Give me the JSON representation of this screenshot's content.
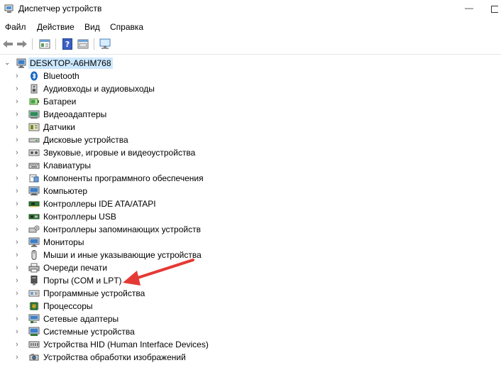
{
  "window": {
    "title": "Диспетчер устройств",
    "minimize_glyph": "—"
  },
  "menu": {
    "items": [
      {
        "label": "Файл"
      },
      {
        "label": "Действие"
      },
      {
        "label": "Вид"
      },
      {
        "label": "Справка"
      }
    ]
  },
  "toolbar": {
    "buttons": [
      "back-arrow-icon",
      "forward-arrow-icon",
      "properties-icon",
      "help-icon",
      "update-driver-icon",
      "scan-hardware-icon"
    ]
  },
  "tree": {
    "root": {
      "label": "DESKTOP-A6HM768",
      "expanded_glyph": "⌄"
    },
    "collapsed_glyph": "›",
    "categories": [
      {
        "label": "Bluetooth",
        "icon": "bluetooth-icon"
      },
      {
        "label": "Аудиовходы и аудиовыходы",
        "icon": "speaker-icon"
      },
      {
        "label": "Батареи",
        "icon": "battery-icon"
      },
      {
        "label": "Видеоадаптеры",
        "icon": "display-adapter-icon"
      },
      {
        "label": "Датчики",
        "icon": "sensor-icon"
      },
      {
        "label": "Дисковые устройства",
        "icon": "disk-drive-icon"
      },
      {
        "label": "Звуковые, игровые и видеоустройства",
        "icon": "sound-icon"
      },
      {
        "label": "Клавиатуры",
        "icon": "keyboard-icon"
      },
      {
        "label": "Компоненты программного обеспечения",
        "icon": "software-component-icon"
      },
      {
        "label": "Компьютер",
        "icon": "computer-icon"
      },
      {
        "label": "Контроллеры IDE ATA/ATAPI",
        "icon": "ide-controller-icon"
      },
      {
        "label": "Контроллеры USB",
        "icon": "usb-icon"
      },
      {
        "label": "Контроллеры запоминающих устройств",
        "icon": "storage-controller-icon"
      },
      {
        "label": "Мониторы",
        "icon": "monitor-icon"
      },
      {
        "label": "Мыши и иные указывающие устройства",
        "icon": "mouse-icon"
      },
      {
        "label": "Очереди печати",
        "icon": "printer-icon"
      },
      {
        "label": "Порты (COM и LPT)",
        "icon": "port-icon"
      },
      {
        "label": "Программные устройства",
        "icon": "software-device-icon"
      },
      {
        "label": "Процессоры",
        "icon": "processor-icon"
      },
      {
        "label": "Сетевые адаптеры",
        "icon": "network-adapter-icon"
      },
      {
        "label": "Системные устройства",
        "icon": "system-device-icon"
      },
      {
        "label": "Устройства HID (Human Interface Devices)",
        "icon": "hid-icon"
      },
      {
        "label": "Устройства обработки изображений",
        "icon": "imaging-device-icon"
      }
    ]
  },
  "colors": {
    "selection": "#cce8ff",
    "arrow": "#e53935",
    "accent": "#2b79c4"
  }
}
